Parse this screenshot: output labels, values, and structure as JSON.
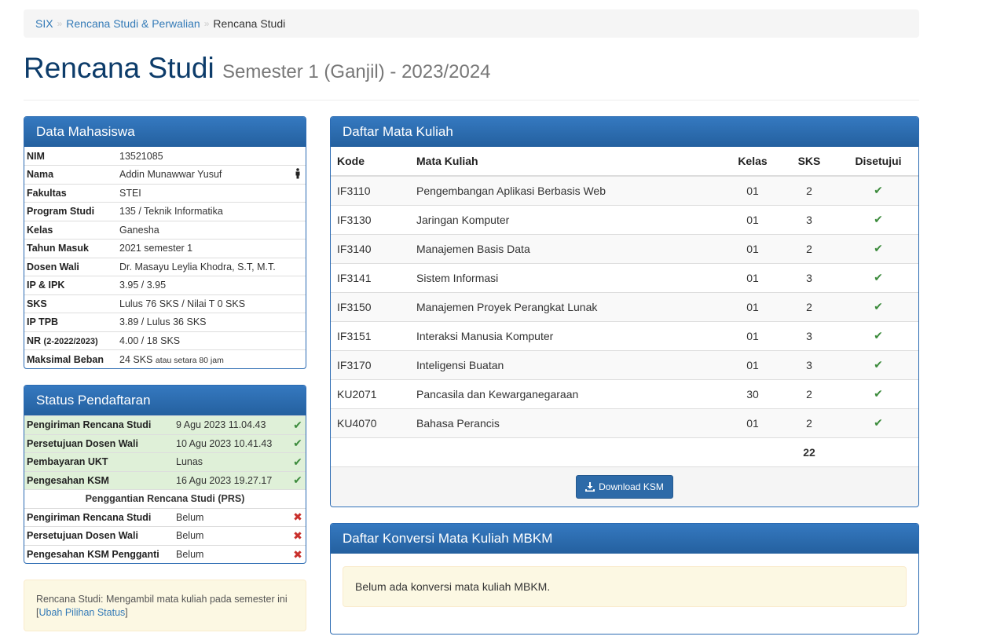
{
  "breadcrumb": {
    "items": [
      "SIX",
      "Rencana Studi & Perwalian"
    ],
    "sep": "»",
    "active": "Rencana Studi"
  },
  "header": {
    "title": "Rencana Studi",
    "subtitle": "Semester 1 (Ganjil) - 2023/2024"
  },
  "student_panel": {
    "title": "Data Mahasiswa",
    "rows": [
      {
        "label": "NIM",
        "value": "13521085"
      },
      {
        "label": "Nama",
        "value": "Addin Munawwar Yusuf",
        "icon": "person-icon"
      },
      {
        "label": "Fakultas",
        "value": "STEI"
      },
      {
        "label": "Program Studi",
        "value": "135 / Teknik Informatika"
      },
      {
        "label": "Kelas",
        "value": "Ganesha"
      },
      {
        "label": "Tahun Masuk",
        "value": "2021 semester 1"
      },
      {
        "label": "Dosen Wali",
        "value": "Dr. Masayu Leylia Khodra, S.T, M.T."
      },
      {
        "label": "IP & IPK",
        "value": "3.95 / 3.95"
      },
      {
        "label": "SKS",
        "value": "Lulus 76 SKS / Nilai T 0 SKS"
      },
      {
        "label": "IP TPB",
        "value": "3.89 / Lulus 36 SKS"
      },
      {
        "label": "NR",
        "label_small": "(2-2022/2023)",
        "value": "4.00 / 18 SKS"
      },
      {
        "label": "Maksimal Beban",
        "value": "24 SKS",
        "value_small": "atau setara 80 jam"
      }
    ]
  },
  "status_panel": {
    "title": "Status Pendaftaran",
    "rows": [
      {
        "label": "Pengiriman Rencana Studi",
        "value": "9 Agu 2023 11.04.43",
        "status": "ok"
      },
      {
        "label": "Persetujuan Dosen Wali",
        "value": "10 Agu 2023 10.41.43",
        "status": "ok"
      },
      {
        "label": "Pembayaran UKT",
        "value": "Lunas",
        "status": "ok"
      },
      {
        "label": "Pengesahan KSM",
        "value": "16 Agu 2023 19.27.17",
        "status": "ok"
      }
    ],
    "prs_title": "Penggantian Rencana Studi (PRS)",
    "prs_rows": [
      {
        "label": "Pengiriman Rencana Studi",
        "value": "Belum",
        "status": "no"
      },
      {
        "label": "Persetujuan Dosen Wali",
        "value": "Belum",
        "status": "no"
      },
      {
        "label": "Pengesahan KSM Pengganti",
        "value": "Belum",
        "status": "no"
      }
    ]
  },
  "note": {
    "text": "Rencana Studi: Mengambil mata kuliah pada semester ini",
    "link_open": "[",
    "link": "Ubah Pilihan Status",
    "link_close": "]"
  },
  "courses_panel": {
    "title": "Daftar Mata Kuliah",
    "columns": [
      "Kode",
      "Mata Kuliah",
      "Kelas",
      "SKS",
      "Disetujui"
    ],
    "rows": [
      {
        "kode": "IF3110",
        "nama": "Pengembangan Aplikasi Berbasis Web",
        "kelas": "01",
        "sks": "2"
      },
      {
        "kode": "IF3130",
        "nama": "Jaringan Komputer",
        "kelas": "01",
        "sks": "3"
      },
      {
        "kode": "IF3140",
        "nama": "Manajemen Basis Data",
        "kelas": "01",
        "sks": "2"
      },
      {
        "kode": "IF3141",
        "nama": "Sistem Informasi",
        "kelas": "01",
        "sks": "3"
      },
      {
        "kode": "IF3150",
        "nama": "Manajemen Proyek Perangkat Lunak",
        "kelas": "01",
        "sks": "2"
      },
      {
        "kode": "IF3151",
        "nama": "Interaksi Manusia Komputer",
        "kelas": "01",
        "sks": "3"
      },
      {
        "kode": "IF3170",
        "nama": "Inteligensi Buatan",
        "kelas": "01",
        "sks": "3"
      },
      {
        "kode": "KU2071",
        "nama": "Pancasila dan Kewarganegaraan",
        "kelas": "30",
        "sks": "2"
      },
      {
        "kode": "KU4070",
        "nama": "Bahasa Perancis",
        "kelas": "01",
        "sks": "2"
      }
    ],
    "total_sks": "22",
    "download_label": "Download KSM"
  },
  "mbkm_panel": {
    "title": "Daftar Konversi Mata Kuliah MBKM",
    "message": "Belum ada konversi mata kuliah MBKM."
  },
  "colors": {
    "primary": "#2d6aa8",
    "heading_text": "#0d3c6a",
    "success_bg": "#dff0d8",
    "check": "#3c8b3c",
    "cross": "#c9302c",
    "warning_bg": "#fcf8e3"
  }
}
